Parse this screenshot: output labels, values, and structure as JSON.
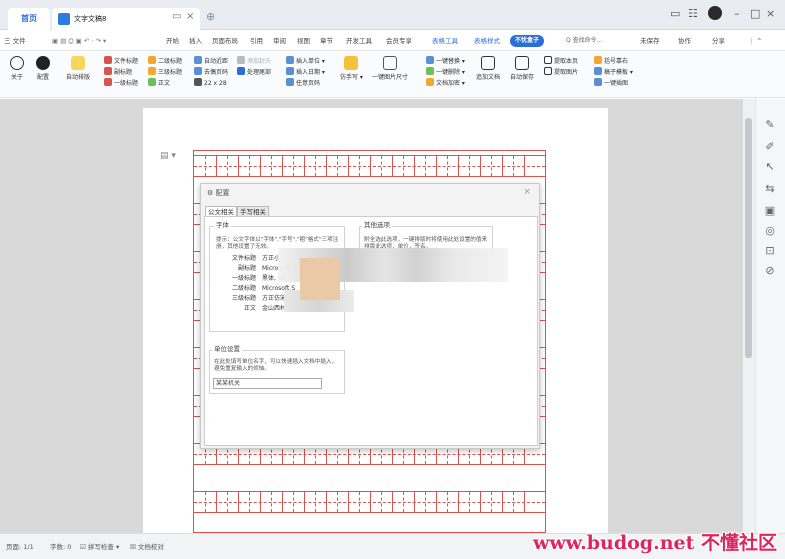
{
  "tabs": {
    "home": "首页",
    "doc_title": "文字文稿8"
  },
  "menubar": {
    "file": "三 文件",
    "items": [
      "开始",
      "插入",
      "页面布局",
      "引用",
      "审阅",
      "视图",
      "章节",
      "开发工具",
      "会员专享"
    ],
    "active_items": [
      "表格工具",
      "表格样式"
    ],
    "pill": "不忧盒子",
    "search": "Q 查找命令...",
    "right": [
      "未保存",
      "协作",
      "分享"
    ]
  },
  "ribbon": {
    "big_buttons": [
      "关于",
      "配置",
      "自动排版"
    ],
    "group1": [
      "文件标题",
      "副标题",
      "一级标题"
    ],
    "group2": [
      "二级标题",
      "三级标题",
      "正文"
    ],
    "group3": [
      "自动近距",
      "去偶页码",
      "22 x 28"
    ],
    "group4": [
      "添加封头",
      "处理尾部"
    ],
    "group5": [
      "插入单位",
      "插入日期",
      "任意页码"
    ],
    "btn_pro": "仿手写",
    "btn_img": "一键图片尺寸",
    "group6": [
      "一键替换",
      "一键删除",
      "文档加密"
    ],
    "btn_add": "追加文档",
    "btn_save": "自动保存",
    "group7": [
      "提取本页",
      "提取图片"
    ],
    "group8": [
      "括号靠右",
      "稿子模板",
      "一键插图"
    ]
  },
  "dialog": {
    "title": "配置",
    "tabs": [
      "公文相关",
      "手写相关"
    ],
    "font_panel": {
      "title": "字体",
      "desc": "提示：公文字体以\"字体\",\"字号\",\"粗\"格式\"三项注册，其他设置了无效。",
      "rows": [
        {
          "label": "文件标题",
          "value": "方正小"
        },
        {
          "label": "副标题",
          "value": "Microsoft"
        },
        {
          "label": "一级标题",
          "value": "黑体, 16"
        },
        {
          "label": "二级标题",
          "value": "Microsoft S"
        },
        {
          "label": "三级标题",
          "value": "方正仿宋_G"
        },
        {
          "label": "正文",
          "value": "金山西林体, 16"
        }
      ]
    },
    "options_panel": {
      "title": "其他选项",
      "desc": "附全选此选项，一键排版时将使用此处设置的值来排版此选项，单位，签名。"
    },
    "unit_panel": {
      "title": "单位设置",
      "desc": "在此处填写单位名字，可以快速插入文档中插入，避免重复输入的烦恼。",
      "input_value": "某某机关"
    }
  },
  "statusbar": {
    "page": "页面: 1/1",
    "words": "字数: 0",
    "spell": "拼写检查",
    "proof": "文档校对"
  },
  "watermark": "www.budog.net 不懂社区",
  "colors": {
    "accent": "#2b6fd6",
    "grid_red": "#d9534f",
    "watermark": "#e0245e"
  }
}
